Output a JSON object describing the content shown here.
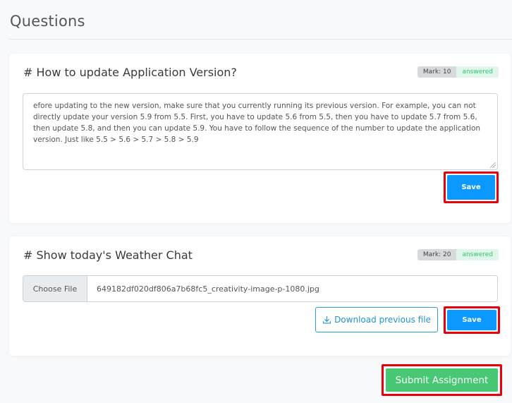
{
  "page": {
    "title": "Questions"
  },
  "questions": [
    {
      "title": "# How to update Application Version?",
      "mark": "Mark: 10",
      "status": "answered",
      "answer_text": "efore updating to the new version, make sure that you currently running its previous version. For example, you can not directly update your version 5.9 from 5.5. First, you have to update 5.6 from 5.5, then you have to update 5.7 from 5.6, then update 5.8, and then you can update 5.9. You have to follow the sequence of the number to update the application version. Just like 5.5 > 5.6 > 5.7 > 5.8 > 5.9",
      "save_label": "Save"
    },
    {
      "title": "# Show today's Weather Chat",
      "mark": "Mark: 20",
      "status": "answered",
      "choose_file_label": "Choose File",
      "file_name": "649182df020df806a7b68fc5_creativity-image-p-1080.jpg",
      "download_label": "Download previous file",
      "save_label": "Save"
    }
  ],
  "submit_label": "Submit Assignment",
  "colors": {
    "save_button": "#0b98ff",
    "submit_button": "#48c774",
    "highlight_border": "#e8000d",
    "answered_text": "#34c07a"
  }
}
